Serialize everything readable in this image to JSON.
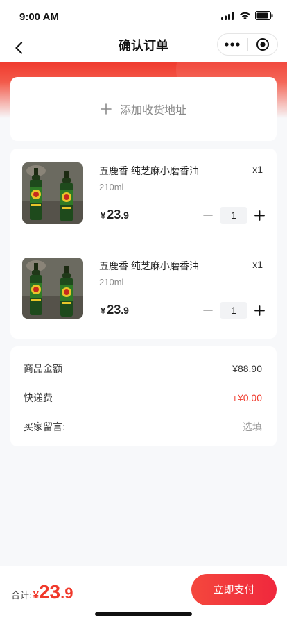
{
  "status_bar": {
    "time": "9:00 AM"
  },
  "nav": {
    "title": "确认订单"
  },
  "address": {
    "add_label": "添加收货地址"
  },
  "goods": [
    {
      "name": "五鹿香 纯芝麻小磨香油",
      "spec": "210ml",
      "qty_label": "x1",
      "price_symbol": "¥",
      "price_int": "23",
      "price_dec": ".9",
      "count": "1"
    },
    {
      "name": "五鹿香 纯芝麻小磨香油",
      "spec": "210ml",
      "qty_label": "x1",
      "price_symbol": "¥",
      "price_int": "23",
      "price_dec": ".9",
      "count": "1"
    }
  ],
  "summary": {
    "goods_amount_label": "商品金额",
    "goods_amount_value": "¥88.90",
    "shipping_label": "快递费",
    "shipping_value": "+¥0.00",
    "message_label": "买家留言:",
    "message_placeholder": "选填"
  },
  "footer": {
    "total_label": "合计:",
    "total_symbol": "¥",
    "total_int": "23",
    "total_dec": ".9",
    "pay_label": "立即支付"
  },
  "colors": {
    "accent": "#f0392b",
    "header_red": "#f03b2f"
  },
  "icons": [
    "signal-icon",
    "wifi-icon",
    "battery-icon",
    "back-icon",
    "more-icon",
    "target-icon",
    "plus-icon",
    "minus-icon"
  ]
}
